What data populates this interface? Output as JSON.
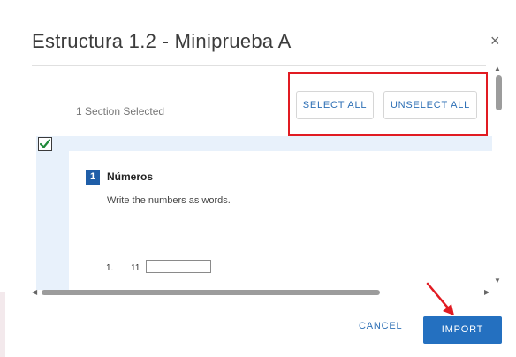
{
  "dialog": {
    "title": "Estructura 1.2 - Miniprueba A",
    "close_glyph": "×"
  },
  "selection": {
    "count_text": "1 Section Selected",
    "select_all_label": "SELECT ALL",
    "unselect_all_label": "UNSELECT ALL"
  },
  "section": {
    "checked": true,
    "number": "1",
    "title": "Números",
    "instruction": "Write the numbers as words.",
    "items": [
      {
        "number": "1.",
        "value": "11",
        "answer": ""
      }
    ]
  },
  "footer": {
    "cancel_label": "CANCEL",
    "import_label": "IMPORT"
  },
  "colors": {
    "accent": "#2470c0",
    "link": "#2d6fb5",
    "annotation": "#e11b22",
    "section_bg": "#e8f1fb"
  },
  "icons": {
    "close": "close-icon",
    "checkbox": "checkmark-icon",
    "arrow": "red-arrow-annotation"
  }
}
